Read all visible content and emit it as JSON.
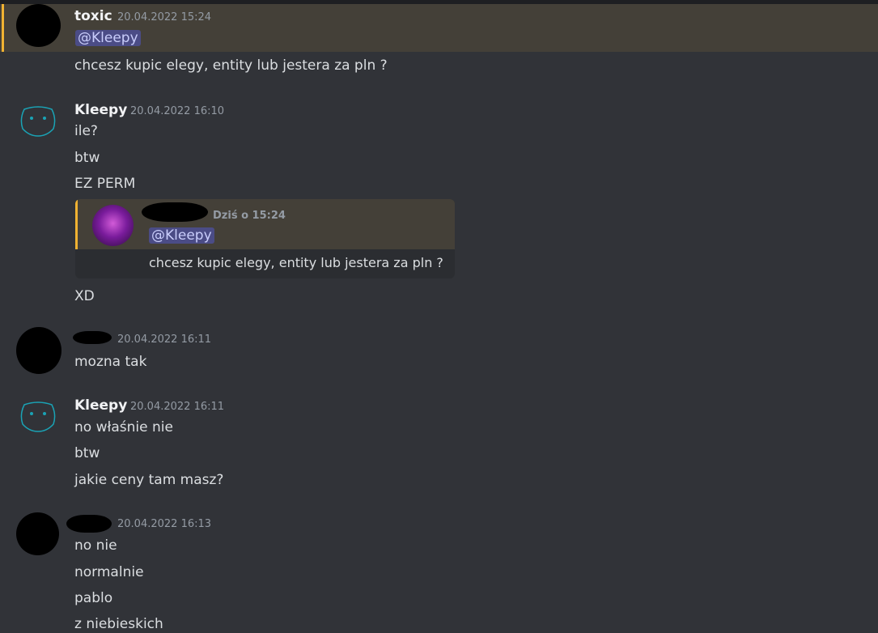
{
  "colors": {
    "background": "#313338",
    "highlight_bg": "#444038",
    "highlight_bar": "#f0b232",
    "mention_bg": "#4b4c86",
    "mention_fg": "#c9cdfb",
    "kleepy_avatar_color": "#1aa3b5"
  },
  "messages": {
    "m1": {
      "author": "toxic",
      "timestamp": "20.04.2022 15:24",
      "mention": "@Kleepy",
      "lines": [
        "chcesz kupic elegy, entity lub jestera za pln ?"
      ]
    },
    "m2": {
      "author": "Kleepy",
      "timestamp": "20.04.2022 16:10",
      "lines": [
        "ile?",
        "btw",
        "EZ PERM"
      ],
      "embed": {
        "timestamp": "Dziś o 15:24",
        "mention": "@Kleepy",
        "text": "chcesz kupic elegy, entity lub jestera za pln ?"
      },
      "after": "XD"
    },
    "m3": {
      "timestamp": "20.04.2022 16:11",
      "lines": [
        "mozna tak"
      ]
    },
    "m4": {
      "author": "Kleepy",
      "timestamp": "20.04.2022 16:11",
      "lines": [
        "no właśnie nie",
        "btw",
        "jakie ceny tam masz?"
      ]
    },
    "m5": {
      "timestamp": "20.04.2022 16:13",
      "lines": [
        "no nie",
        "normalnie",
        "pablo",
        "z niebieskich"
      ]
    }
  }
}
